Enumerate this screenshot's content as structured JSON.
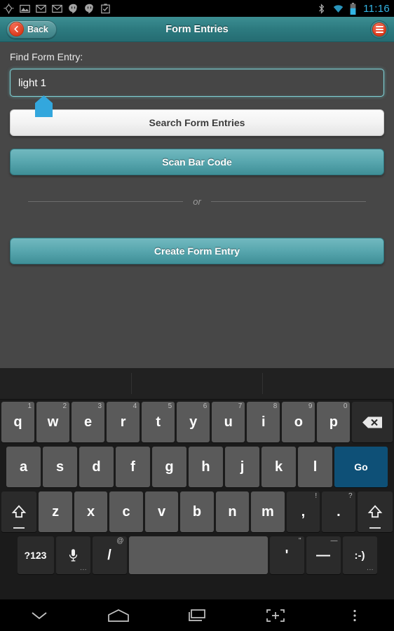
{
  "statusbar": {
    "icons": [
      "location-crosshair-icon",
      "photo-icon",
      "gmail-icon",
      "gmail-icon-2",
      "hangouts-icon",
      "hangouts-icon-2",
      "clipboard-check-icon"
    ],
    "bluetooth": "bluetooth-icon",
    "wifi": "wifi-icon",
    "battery": "battery-icon",
    "time": "11:16",
    "time_color": "#33b5e5"
  },
  "header": {
    "back_label": "Back",
    "title": "Form Entries",
    "menu_icon": "hamburger-menu-icon",
    "accent_teal": "#2d7b80",
    "accent_red": "#d93a1c"
  },
  "main": {
    "field_label": "Find Form Entry:",
    "search_value": "light 1",
    "search_placeholder": "Find Form Entry",
    "search_button": "Search Form Entries",
    "scan_button": "Scan Bar Code",
    "divider_text": "or",
    "create_button": "Create Form Entry",
    "cursor_handle": "text-cursor-handle",
    "background": "#474747",
    "field_glow": "#7fd0d4"
  },
  "keyboard": {
    "row1": [
      {
        "label": "q",
        "sup": "1"
      },
      {
        "label": "w",
        "sup": "2"
      },
      {
        "label": "e",
        "sup": "3"
      },
      {
        "label": "r",
        "sup": "4"
      },
      {
        "label": "t",
        "sup": "5"
      },
      {
        "label": "y",
        "sup": "6"
      },
      {
        "label": "u",
        "sup": "7"
      },
      {
        "label": "i",
        "sup": "8"
      },
      {
        "label": "o",
        "sup": "9"
      },
      {
        "label": "p",
        "sup": "0"
      }
    ],
    "backspace": "backspace-icon",
    "row2": [
      {
        "label": "a"
      },
      {
        "label": "s"
      },
      {
        "label": "d"
      },
      {
        "label": "f"
      },
      {
        "label": "g"
      },
      {
        "label": "h"
      },
      {
        "label": "j"
      },
      {
        "label": "k"
      },
      {
        "label": "l"
      }
    ],
    "go_label": "Go",
    "go_color": "#0e5077",
    "row3": [
      {
        "label": "z"
      },
      {
        "label": "x"
      },
      {
        "label": "c"
      },
      {
        "label": "v"
      },
      {
        "label": "b"
      },
      {
        "label": "n"
      },
      {
        "label": "m"
      },
      {
        "label": ",",
        "sup": "!"
      },
      {
        "label": ".",
        "sup": "?"
      }
    ],
    "shift_icon": "shift-arrow-icon",
    "row4": {
      "symbols_label": "?123",
      "mic_icon": "microphone-icon",
      "slash_label": "/",
      "slash_sup": "@",
      "space_label": "",
      "apostrophe_label": "'",
      "apostrophe_sup": "\"",
      "dash_label": "—",
      "dash_sup": "—",
      "emoticon_label": ":-)"
    }
  },
  "navbar": {
    "items": [
      "hide-keyboard-chevron-icon",
      "home-icon",
      "recents-icon",
      "screenshot-icon",
      "overflow-menu-icon"
    ]
  }
}
